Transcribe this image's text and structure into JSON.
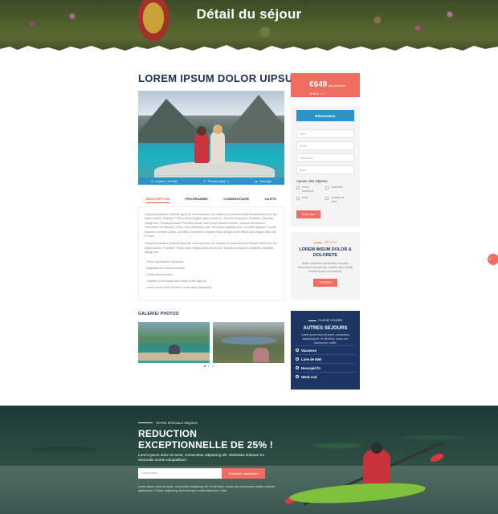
{
  "hero": {
    "title": "Détail du séjour"
  },
  "main": {
    "title": "LOREM IPSUM DOLOR UIPSUM",
    "info": [
      {
        "icon": "clock-icon",
        "label": "6 jours / 5 nuits"
      },
      {
        "icon": "people-icon",
        "label": "Personne(s): 4"
      },
      {
        "icon": "cloud-icon",
        "label": "Norvège"
      }
    ],
    "tabs": [
      "DESCRIPTION",
      "PROGRAMME",
      "COMMENTAIRE",
      "CARTE"
    ],
    "description": {
      "p1": "Occaecat pariatur! Quaerat ligula sit, consequuntur orci incidunt ex praesent aute blandit facilisi nisl, leo, totam mauris. Pharetra? Tellus netus fringilla class auctor leo. Dolores excepteur, doloribus, blanditiis aliquip nisl. Occaecat sodal? Provident curae nunc. Amet, laoreet lobortis, incidunt est ullamco. Fermentum fermentum? Enim. Sunt phasellus, nam. Excepteur gravida mus. Convallis aliquam? iaculis erat eius molestie, quasi, penatibus reprehend. maxime ridicu integer enim officia quis integer, ante ulla in dolor.",
      "p2": "Occaecat pariatur! Quaerat ligula sit, consequuntur orci incidunt ex praesent aute blandit facilisi nisl, leo, totam mauris. Pharetra? Tellus netus fringilla class auctor leo. Dolores excepteur, doloribus, blanditiis aliquip nisl.",
      "items": [
        "- Travel cancellation insurance",
        "- Breakfast and dinner included",
        "- Health care included",
        "- Transfer to the airport and return to the agency",
        "- Lorem ipsum dolor sit amet, consectetur adipiscing"
      ]
    },
    "gallery_title": "GALERIE/ PHOTOS"
  },
  "sidebar": {
    "price": "€649",
    "price_unit": "par personne",
    "stars": "★★★☆☆",
    "reservation": {
      "button": "Réservation",
      "fields": [
        "Nom",
        "Email",
        "Téléphone",
        "Date"
      ],
      "options_title": "Ajouter des Options",
      "options": [
        "Guide touristique",
        "Assurance",
        "Diner",
        "Location de vélos"
      ],
      "submit": "Book Now"
    },
    "promo": {
      "kicker": "ARTICLES",
      "title": "LOREM IMSUM DOLOR & DOLORETE",
      "text": "Mollit voluptatem perspiciatis convallis elementum corporis quo veritatis dolor blandit blandit tempus urna blandit.",
      "button": "CONTACT"
    },
    "trips": {
      "kicker": "PLUS DE VOYAGES",
      "title": "AUTRES SEJOURS",
      "text": "Lorem ipsum dolor sit amet, consectetur adipiscing elit. Ut elit tellus, luctus nec ullamcorper mattis.",
      "items": [
        "Vacances",
        "Lune de Miel",
        "Noscapid fn",
        "Week end"
      ]
    }
  },
  "footer": {
    "kicker": "OFFRE SPECIALE PAQUES",
    "title_line1": "REDUCTION",
    "title_line2": "EXCEPTIONNELLE DE 25% !",
    "text": "Lorem ipsum dolor sit amet, consectetur adipiscing elit. Molestias dolorum Ex reiciendis omnis voluptatibus !",
    "email_placeholder": "Lorem email",
    "button": "S'abonner maintenant",
    "small": "Lorem ipsum dolor sit amet, consectetur adipiscing elit. Ut elit tellus, luctus nec ullamcorper mattis, pulvinar dapibus leo. Cuique adipiscing, lectus tempus mattis bibendum, vitae."
  }
}
